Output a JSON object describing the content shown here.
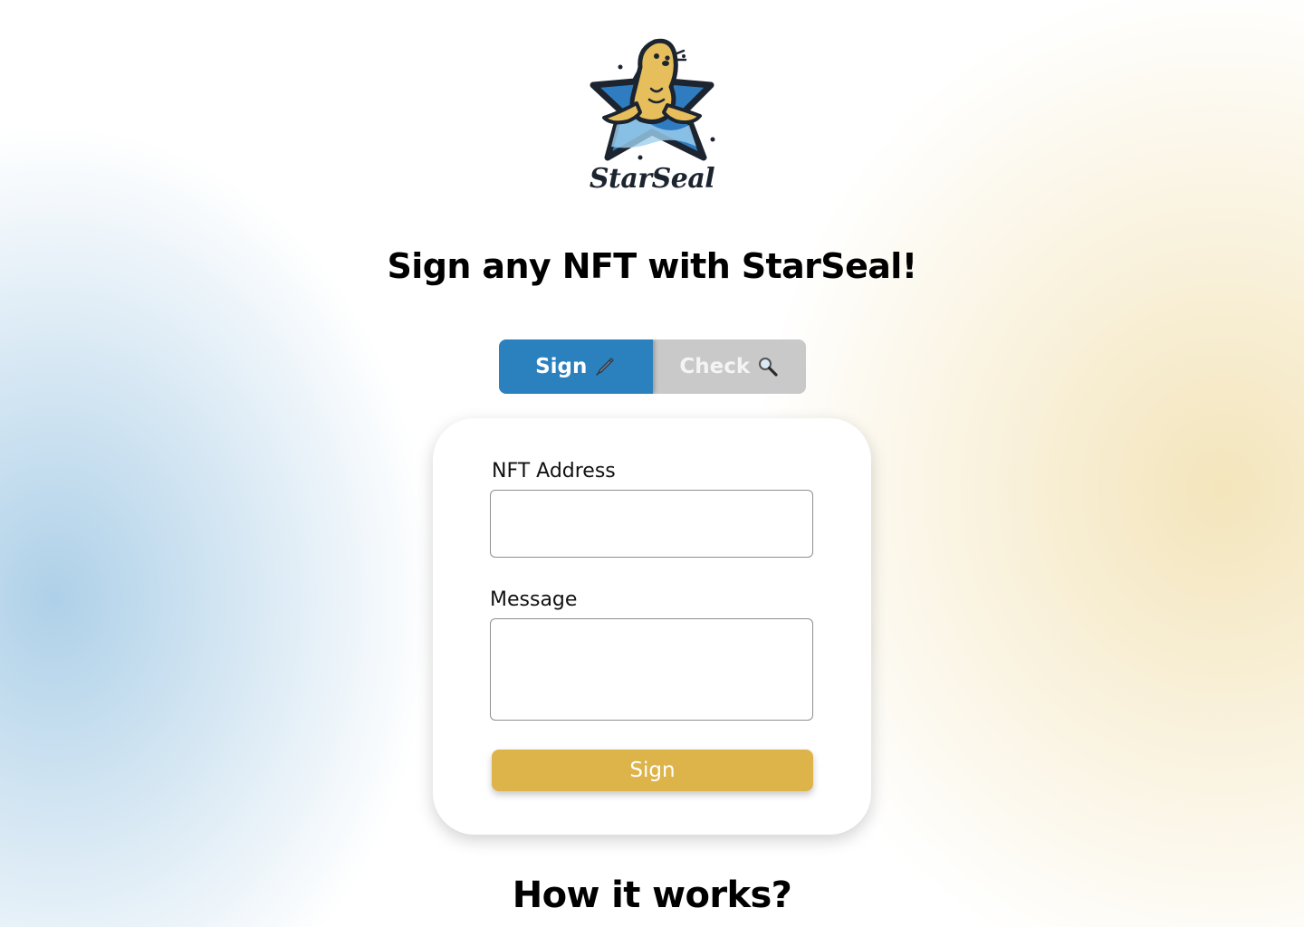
{
  "brand": {
    "name": "StarSeal",
    "logo_icon": "starseal-logo-icon"
  },
  "headline": "Sign any NFT with StarSeal!",
  "tabs": [
    {
      "label": "Sign",
      "icon": "pen-icon",
      "active": true
    },
    {
      "label": "Check",
      "icon": "magnifier-icon",
      "active": false
    }
  ],
  "form": {
    "nft_address_label": "NFT Address",
    "nft_address_value": "",
    "nft_address_placeholder": "",
    "message_label": "Message",
    "message_value": "",
    "message_placeholder": "",
    "submit_label": "Sign"
  },
  "how_it_works": "How it works?",
  "colors": {
    "primary_blue": "#2b80be",
    "accent_gold": "#ddb44a",
    "tab_inactive": "#c9c9c9",
    "seal_gold": "#e6be5c",
    "outline_dark": "#1c2430"
  }
}
